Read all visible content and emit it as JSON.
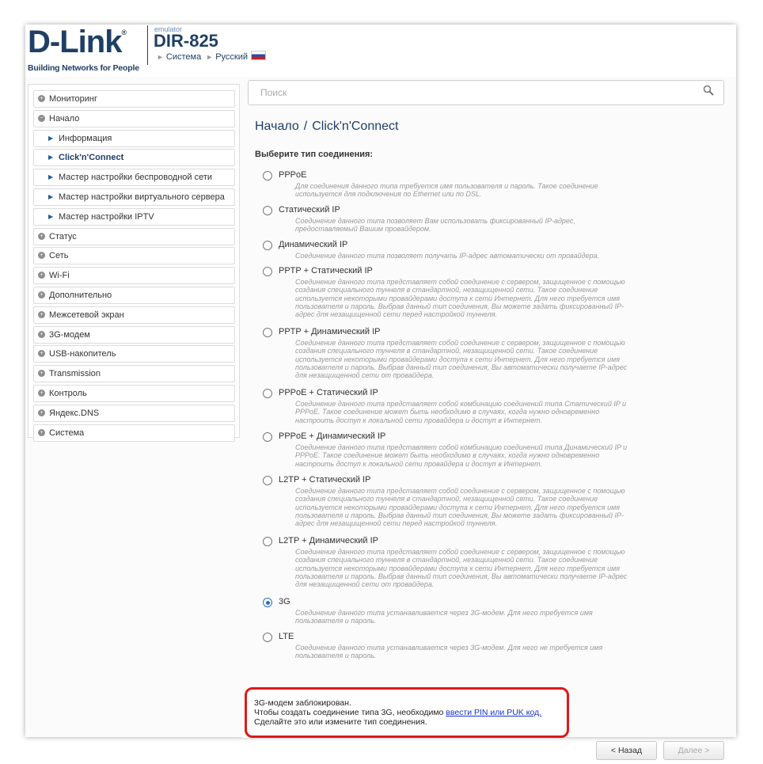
{
  "header": {
    "logo_text": "D-Link",
    "logo_reg": "®",
    "logo_tagline": "Building Networks for People",
    "emulator": "emulator",
    "model": "DIR-825",
    "link_system": "Система",
    "link_language": "Русский",
    "flag_icon": "russia-flag-icon"
  },
  "sidebar": {
    "items": [
      {
        "label": "Мониторинг",
        "type": "top",
        "icon": "plus"
      },
      {
        "label": "Начало",
        "type": "top",
        "icon": "minus"
      },
      {
        "label": "Информация",
        "type": "sub"
      },
      {
        "label": "Click'n'Connect",
        "type": "sub",
        "active": true
      },
      {
        "label": "Мастер настройки беспроводной сети",
        "type": "sub"
      },
      {
        "label": "Мастер настройки виртуального сервера",
        "type": "sub"
      },
      {
        "label": "Мастер настройки IPTV",
        "type": "sub"
      },
      {
        "label": "Статус",
        "type": "top",
        "icon": "plus"
      },
      {
        "label": "Сеть",
        "type": "top",
        "icon": "plus"
      },
      {
        "label": "Wi-Fi",
        "type": "top",
        "icon": "plus"
      },
      {
        "label": "Дополнительно",
        "type": "top",
        "icon": "plus"
      },
      {
        "label": "Межсетевой экран",
        "type": "top",
        "icon": "plus"
      },
      {
        "label": "3G-модем",
        "type": "top",
        "icon": "plus"
      },
      {
        "label": "USB-накопитель",
        "type": "top",
        "icon": "plus"
      },
      {
        "label": "Transmission",
        "type": "top",
        "icon": "plus"
      },
      {
        "label": "Контроль",
        "type": "top",
        "icon": "plus"
      },
      {
        "label": "Яндекс.DNS",
        "type": "top",
        "icon": "plus"
      },
      {
        "label": "Система",
        "type": "top",
        "icon": "plus"
      }
    ]
  },
  "search": {
    "placeholder": "Поиск",
    "icon": "magnifier-icon"
  },
  "breadcrumb": {
    "part1": "Начало",
    "sep": "/",
    "part2": "Click'n'Connect"
  },
  "section_title": "Выберите тип соединения:",
  "options": [
    {
      "name": "PPPoE",
      "selected": false,
      "desc": [
        "Для соединения данного типа требуется имя пользователя и пароль. Такое соединение",
        "используется для подключения по Ethernet или по DSL."
      ]
    },
    {
      "name": "Статический IP",
      "selected": false,
      "desc": [
        "Соединение данного типа позволяет Вам использовать фиксированный IP-адрес,",
        "предоставляемый Вашим провайдером."
      ]
    },
    {
      "name": "Динамический IP",
      "selected": false,
      "desc": [
        "Соединение данного типа позволяет получать IP-адрес автоматически от провайдера."
      ]
    },
    {
      "name": "PPTP + Статический IP",
      "selected": false,
      "desc": [
        "Соединение данного типа представляет собой соединение с сервером, защищенное с помощью",
        "создания специального туннеля в стандартной, незащищенной сети. Такое соединение",
        "используется некоторыми провайдерами доступа к сети Интернет. Для него требуется имя",
        "пользователя и пароль. Выбрав данный тип соединения, Вы можете задать фиксированный IP-",
        "адрес для незащищенной сети перед настройкой туннеля."
      ]
    },
    {
      "name": "PPTP + Динамический IP",
      "selected": false,
      "desc": [
        "Соединение данного типа представляет собой соединение с сервером, защищенное с помощью",
        "создания специального туннеля в стандартной, незащищенной сети. Такое соединение",
        "используется некоторыми провайдерами доступа к сети Интернет. Для него требуется имя",
        "пользователя и пароль. Выбрав данный тип соединения, Вы автоматически получаете IP-адрес",
        "для незащищенной сети от провайдера."
      ]
    },
    {
      "name": "PPPoE + Статический IP",
      "selected": false,
      "desc": [
        "Соединение данного типа представляет собой комбинацию соединений типа Статический IP и",
        "PPPoE. Такое соединение может быть необходимо в случаях, когда нужно одновременно",
        "настроить доступ к локальной сети провайдера и доступ в Интернет."
      ]
    },
    {
      "name": "PPPoE + Динамический IP",
      "selected": false,
      "desc": [
        "Соединение данного типа представляет собой комбинацию соединений типа Динамический IP и",
        "PPPoE. Такое соединение может быть необходимо в случаях, когда нужно одновременно",
        "настроить доступ к локальной сети провайдера и доступ в Интернет."
      ]
    },
    {
      "name": "L2TP + Статический IP",
      "selected": false,
      "desc": [
        "Соединение данного типа представляет собой соединение с сервером, защищенное с помощью",
        "создания специального туннеля в стандартной, незащищенной сети. Такое соединение",
        "используется некоторыми провайдерами доступа к сети Интернет. Для него требуется имя",
        "пользователя и пароль. Выбрав данный тип соединения, Вы можете задать фиксированный IP-",
        "адрес для незащищенной сети перед настройкой туннеля."
      ]
    },
    {
      "name": "L2TP + Динамический IP",
      "selected": false,
      "desc": [
        "Соединение данного типа представляет собой соединение с сервером, защищенное с помощью",
        "создания специального туннеля в стандартной, незащищенной сети. Такое соединение",
        "используется некоторыми провайдерами доступа к сети Интернет. Для него требуется имя",
        "пользователя и пароль. Выбрав данный тип соединения, Вы автоматически получаете IP-адрес",
        "для незащищенной сети от провайдера."
      ]
    },
    {
      "name": "3G",
      "selected": true,
      "desc": [
        "Соединение данного типа устанавливается через 3G-модем. Для него требуется имя",
        "пользователя и пароль."
      ]
    },
    {
      "name": "LTE",
      "selected": false,
      "desc": [
        "Соединение данного типа устанавливается через 3G-модем. Для него не требуется имя",
        "пользователя и пароль."
      ]
    }
  ],
  "notice": {
    "line1": "3G-модем заблокирован.",
    "line2_prefix": "Чтобы создать соединение типа 3G, необходимо ",
    "line2_link": "ввести PIN или PUK код.",
    "line3": "Сделайте это или измените тип соединения."
  },
  "buttons": {
    "back": "< Назад",
    "next": "Далее >"
  },
  "colors": {
    "brand": "#1f3f66",
    "highlight_border": "#e01818",
    "link": "#1a33cc",
    "radio_selected": "#2a6ec4"
  }
}
